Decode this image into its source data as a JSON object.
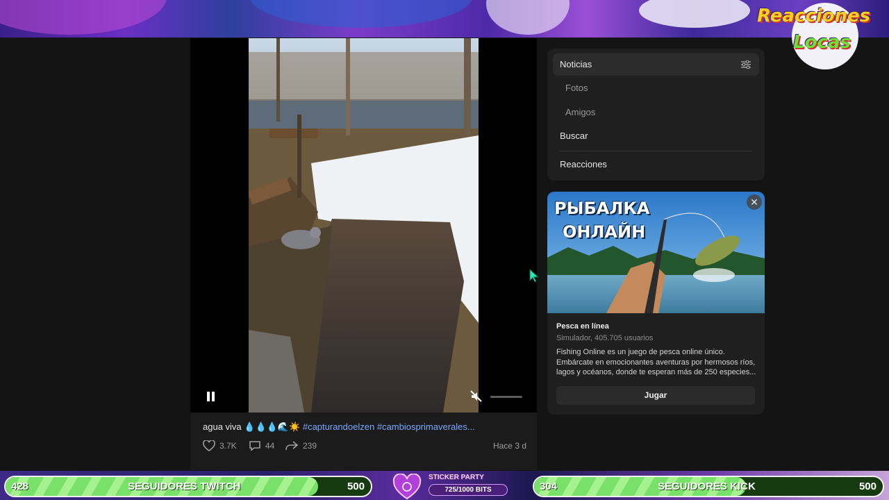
{
  "video": {
    "caption_text": "agua viva",
    "caption_emoji": "💧💧💧🌊☀️",
    "caption_tags": "#capturandoelzen #cambiosprimaverales...",
    "likes": "3.7K",
    "comments": "44",
    "shares": "239",
    "time_ago": "Hace 3 d"
  },
  "menu": {
    "items": [
      {
        "label": "Noticias"
      },
      {
        "label": "Fotos"
      },
      {
        "label": "Amigos"
      },
      {
        "label": "Buscar"
      },
      {
        "label": "Reacciones"
      }
    ]
  },
  "ad": {
    "headline_line1": "РЫБАЛКА",
    "headline_line2": "ОНЛАЙН",
    "title": "Pesca en línea",
    "subtitle": "Simulador, 405.705 usuarios",
    "description": "Fishing Online es un juego de pesca online único. Embárcate en emocionantes aventuras por hermosos ríos, lagos y océanos, donde te esperan más de 250 especies...",
    "button": "Jugar",
    "close": "✕"
  },
  "overlay": {
    "logo_line1": "Reacciones",
    "logo_line2": "Locas",
    "twitch": {
      "current": "428",
      "label": "SEGUIDORES TWITCH",
      "goal": "500",
      "progress": 0.856
    },
    "kick": {
      "current": "304",
      "label": "SEGUIDORES KICK",
      "goal": "500",
      "progress": 0.608
    },
    "sticker": {
      "title": "STICKER PARTY",
      "progress_text": "725/1000 BITS",
      "progress": 0.725
    }
  },
  "colors": {
    "accent_link": "#7aa9ff",
    "progress_green": "#79e06a",
    "cursor": "#2ee6b0"
  }
}
